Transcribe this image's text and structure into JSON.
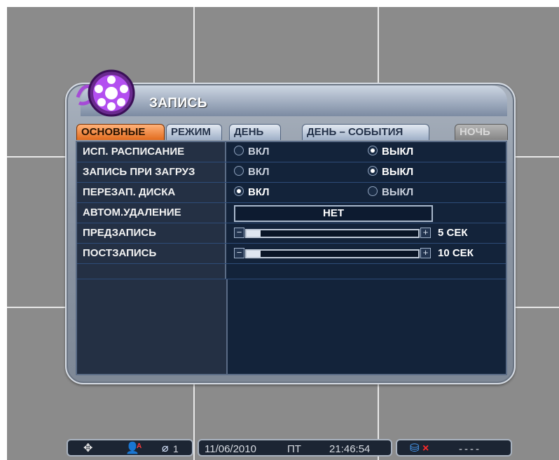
{
  "dialog": {
    "title": "ЗАПИСЬ"
  },
  "tabs": [
    {
      "label": "ОСНОВНЫЕ",
      "state": "active"
    },
    {
      "label": "РЕЖИМ",
      "state": "normal"
    },
    {
      "label": "ДЕНЬ",
      "state": "normal"
    },
    {
      "label": "ДЕНЬ – СОБЫТИЯ",
      "state": "normal"
    },
    {
      "label": "НОЧЬ",
      "state": "disabled"
    }
  ],
  "settings": {
    "schedule": {
      "label": "ИСП. РАСПИСАНИЕ",
      "on_label": "ВКЛ",
      "off_label": "ВЫКЛ",
      "selected": "off"
    },
    "boot_record": {
      "label": "ЗАПИСЬ ПРИ ЗАГРУЗ",
      "on_label": "ВКЛ",
      "off_label": "ВЫКЛ",
      "selected": "off"
    },
    "overwrite": {
      "label": "ПЕРЕЗАП. ДИСКА",
      "on_label": "ВКЛ",
      "off_label": "ВЫКЛ",
      "selected": "on"
    },
    "auto_delete": {
      "label": "АВТОМ.УДАЛЕНИЕ",
      "value": "НЕТ"
    },
    "pre_record": {
      "label": "ПРЕДЗАПИСЬ",
      "value_text": "5 СЕК",
      "level": 0.02
    },
    "post_record": {
      "label": "ПОСТЗАПИСЬ",
      "value_text": "10 СЕК",
      "level": 0.04
    }
  },
  "statusbar": {
    "icons": [
      "move-icon",
      "user-icon",
      "camera-off-icon"
    ],
    "camera_number": "1",
    "date": "11/06/2010",
    "weekday": "ПТ",
    "time": "21:46:54",
    "disk_status": "----",
    "colors": {
      "accent": "#e26b1e",
      "alert": "#ff2a2a",
      "disk": "#4aa3ff"
    }
  }
}
